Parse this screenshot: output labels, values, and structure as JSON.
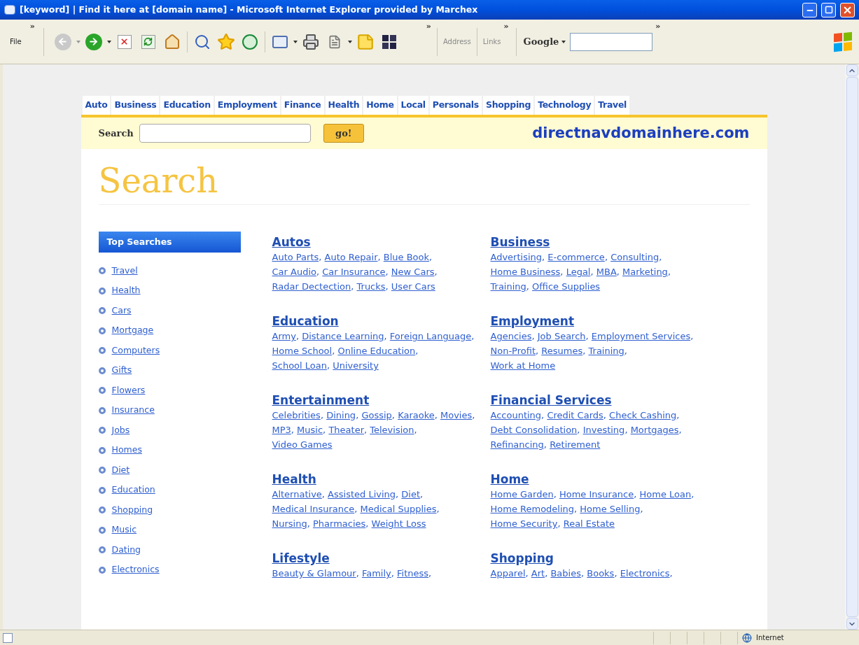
{
  "window": {
    "title": "[keyword] | Find it here at [domain name] - Microsoft Internet Explorer provided by Marchex"
  },
  "toolbar": {
    "menu": "File",
    "address_label": "Address",
    "links_label": "Links",
    "google_label": "Google",
    "chevron": "»"
  },
  "nav_tabs": [
    {
      "label": "Auto"
    },
    {
      "label": "Business"
    },
    {
      "label": "Education"
    },
    {
      "label": "Employment"
    },
    {
      "label": "Finance"
    },
    {
      "label": "Health"
    },
    {
      "label": "Home"
    },
    {
      "label": "Local"
    },
    {
      "label": "Personals"
    },
    {
      "label": "Shopping"
    },
    {
      "label": "Technology"
    },
    {
      "label": "Travel"
    }
  ],
  "search_bar": {
    "label": "Search",
    "button": "go!",
    "domain": "directnavdomainhere.com"
  },
  "page_title": "Search",
  "top_searches": {
    "title": "Top Searches",
    "items": [
      "Travel",
      "Health",
      "Cars",
      "Mortgage",
      "Computers",
      "Gifts",
      "Flowers",
      "Insurance",
      "Jobs",
      "Homes",
      "Diet",
      "Education",
      "Shopping",
      "Music",
      "Dating",
      "Electronics"
    ]
  },
  "link_separator": ",",
  "categories": [
    {
      "title": "Autos",
      "links": [
        "Auto Parts",
        "Auto Repair",
        "Blue Book",
        "Car Audio",
        "Car Insurance",
        "New Cars",
        "Radar Dectection",
        "Trucks",
        "User Cars"
      ]
    },
    {
      "title": "Business",
      "links": [
        "Advertising",
        "E-commerce",
        "Consulting",
        "Home Business",
        "Legal",
        "MBA",
        "Marketing",
        "Training",
        "Office Supplies"
      ]
    },
    {
      "title": "Education",
      "links": [
        "Army",
        "Distance Learning",
        "Foreign Language",
        "Home School",
        "Online Education",
        "School Loan",
        "University"
      ]
    },
    {
      "title": "Employment",
      "links": [
        "Agencies",
        "Job Search",
        "Employment Services",
        "Non-Profit",
        "Resumes",
        "Training",
        "Work at Home"
      ]
    },
    {
      "title": "Entertainment",
      "links": [
        "Celebrities",
        "Dining",
        "Gossip",
        "Karaoke",
        "Movies",
        "MP3",
        "Music",
        "Theater",
        "Television",
        "Video Games"
      ]
    },
    {
      "title": "Financial Services",
      "links": [
        "Accounting",
        "Credit Cards",
        "Check Cashing",
        "Debt Consolidation",
        "Investing",
        "Mortgages",
        "Refinancing",
        "Retirement"
      ]
    },
    {
      "title": "Health",
      "links": [
        "Alternative",
        "Assisted Living",
        "Diet",
        "Medical Insurance",
        "Medical Supplies",
        "Nursing",
        "Pharmacies",
        "Weight Loss"
      ]
    },
    {
      "title": "Home",
      "links": [
        "Home Garden",
        "Home Insurance",
        "Home Loan",
        "Home Remodeling",
        "Home Selling",
        "Home Security",
        "Real Estate"
      ]
    },
    {
      "title": "Lifestyle",
      "links": [
        "Beauty & Glamour",
        "Family",
        "Fitness"
      ],
      "trailing_separator": true
    },
    {
      "title": "Shopping",
      "links": [
        "Apparel",
        "Art",
        "Babies",
        "Books",
        "Electronics"
      ],
      "trailing_separator": true
    }
  ],
  "status_bar": {
    "zone": "Internet"
  }
}
